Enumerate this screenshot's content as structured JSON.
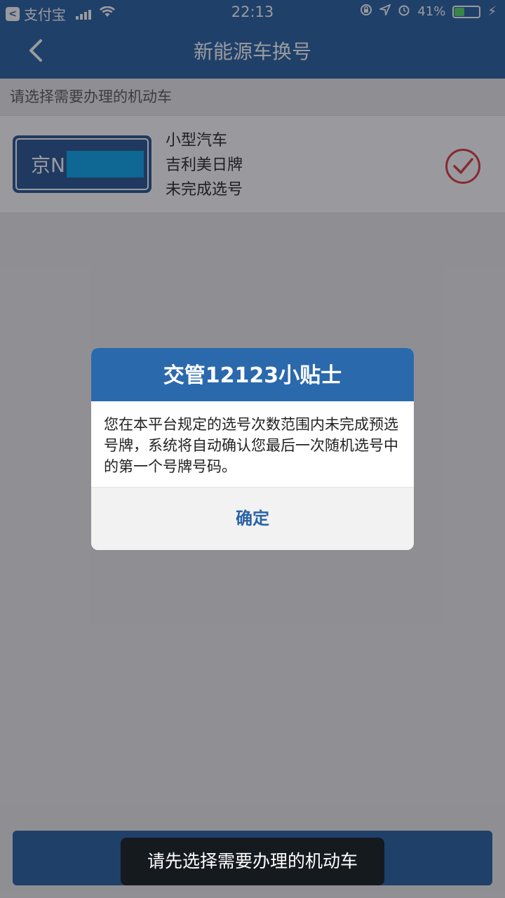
{
  "status_bar": {
    "app_back_label": "支付宝",
    "time": "22:13",
    "battery": "41%",
    "battery_fraction": 0.41
  },
  "nav": {
    "title": "新能源车换号"
  },
  "section_label": "请选择需要办理的机动车",
  "vehicle": {
    "plate_prefix": "京N",
    "type": "小型汽车",
    "brand": "吉利美日牌",
    "status": "未完成选号"
  },
  "dialog": {
    "title": "交管12123小贴士",
    "message": "您在本平台规定的选号次数范围内未完成预选号牌，系统将自动确认您最后一次随机选号中的第一个号牌号码。",
    "ok_label": "确定"
  },
  "toast": "请先选择需要办理的机动车",
  "colors": {
    "primary": "#1f5c9e",
    "dialog_header": "#2b69ad",
    "check": "#d9363e",
    "plate_mask": "#00a5ec"
  }
}
